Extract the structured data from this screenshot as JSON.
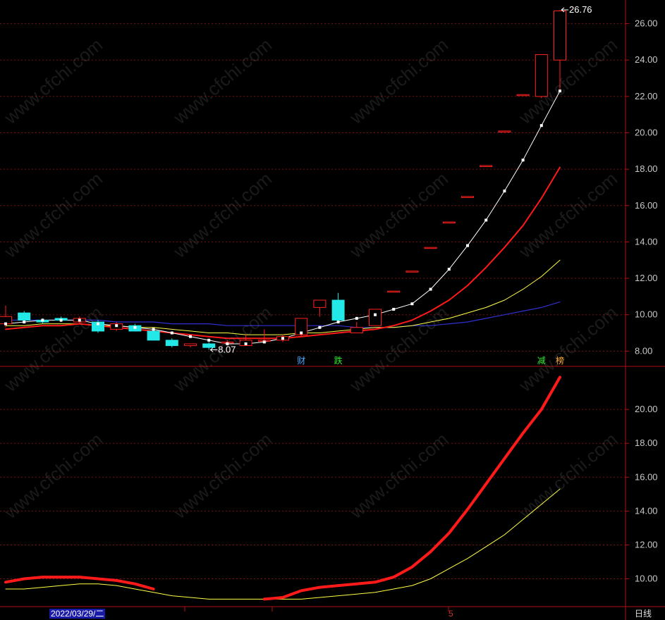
{
  "chart_data": [
    {
      "type": "candlestick",
      "ylim": [
        7.2,
        27.3
      ],
      "yticks": [
        8,
        10,
        12,
        14,
        16,
        18,
        20,
        22,
        24,
        26
      ],
      "ytick_labels": [
        "8.00",
        "10.00",
        "12.00",
        "14.00",
        "16.00",
        "18.00",
        "20.00",
        "22.00",
        "24.00",
        "26.00"
      ],
      "grid": true,
      "candles": [
        {
          "o": 9.5,
          "h": 10.5,
          "l": 9.3,
          "c": 9.9
        },
        {
          "o": 10.1,
          "h": 10.2,
          "l": 9.7,
          "c": 9.7
        },
        {
          "o": 9.7,
          "h": 9.8,
          "l": 9.5,
          "c": 9.6
        },
        {
          "o": 9.8,
          "h": 9.9,
          "l": 9.6,
          "c": 9.7
        },
        {
          "o": 9.6,
          "h": 9.9,
          "l": 9.5,
          "c": 9.8
        },
        {
          "o": 9.6,
          "h": 9.7,
          "l": 9.0,
          "c": 9.1
        },
        {
          "o": 9.2,
          "h": 9.6,
          "l": 9.1,
          "c": 9.5
        },
        {
          "o": 9.4,
          "h": 9.5,
          "l": 9.1,
          "c": 9.1
        },
        {
          "o": 9.1,
          "h": 9.2,
          "l": 8.6,
          "c": 8.6
        },
        {
          "o": 8.6,
          "h": 8.7,
          "l": 8.2,
          "c": 8.3
        },
        {
          "o": 8.3,
          "h": 8.4,
          "l": 8.2,
          "c": 8.4
        },
        {
          "o": 8.4,
          "h": 8.5,
          "l": 8.07,
          "c": 8.2
        },
        {
          "o": 8.5,
          "h": 8.6,
          "l": 8.3,
          "c": 8.5
        },
        {
          "o": 8.3,
          "h": 8.9,
          "l": 8.3,
          "c": 8.6
        },
        {
          "o": 8.6,
          "h": 9.2,
          "l": 8.5,
          "c": 8.6
        },
        {
          "o": 8.6,
          "h": 8.9,
          "l": 8.5,
          "c": 8.8
        },
        {
          "o": 8.9,
          "h": 9.8,
          "l": 8.8,
          "c": 9.8
        },
        {
          "o": 10.4,
          "h": 10.8,
          "l": 9.9,
          "c": 10.8
        },
        {
          "o": 10.8,
          "h": 11.2,
          "l": 9.6,
          "c": 9.7
        },
        {
          "o": 9.0,
          "h": 9.6,
          "l": 9.0,
          "c": 9.3
        },
        {
          "o": 9.4,
          "h": 10.3,
          "l": 9.4,
          "c": 10.3
        },
        {
          "o": 11.3,
          "h": 11.3,
          "l": 11.3,
          "c": 11.3
        },
        {
          "o": 12.4,
          "h": 12.4,
          "l": 12.4,
          "c": 12.4
        },
        {
          "o": 13.7,
          "h": 13.7,
          "l": 13.7,
          "c": 13.7
        },
        {
          "o": 15.1,
          "h": 15.1,
          "l": 15.1,
          "c": 15.1
        },
        {
          "o": 16.5,
          "h": 16.5,
          "l": 16.5,
          "c": 16.5
        },
        {
          "o": 18.2,
          "h": 18.2,
          "l": 18.2,
          "c": 18.2
        },
        {
          "o": 20.1,
          "h": 20.1,
          "l": 20.1,
          "c": 20.1
        },
        {
          "o": 22.1,
          "h": 22.1,
          "l": 22.1,
          "c": 22.1
        },
        {
          "o": 22.0,
          "h": 24.3,
          "l": 21.9,
          "c": 24.3
        },
        {
          "o": 24.0,
          "h": 26.76,
          "l": 22.4,
          "c": 26.7
        }
      ],
      "series": [
        {
          "color": "#ffffff",
          "markers": true,
          "values": [
            9.5,
            9.6,
            9.7,
            9.7,
            9.7,
            9.5,
            9.4,
            9.3,
            9.2,
            9.0,
            8.8,
            8.6,
            8.4,
            8.4,
            8.5,
            8.7,
            9.0,
            9.3,
            9.6,
            9.8,
            10.0,
            10.3,
            10.6,
            11.4,
            12.5,
            13.8,
            15.2,
            16.8,
            18.5,
            20.4,
            22.3
          ]
        },
        {
          "color": "#ff1a1a",
          "values": [
            9.2,
            9.3,
            9.4,
            9.4,
            9.5,
            9.4,
            9.3,
            9.2,
            9.1,
            9.0,
            8.9,
            8.8,
            8.7,
            8.7,
            8.7,
            8.7,
            8.8,
            8.9,
            9.0,
            9.1,
            9.2,
            9.4,
            9.7,
            10.2,
            10.8,
            11.6,
            12.6,
            13.7,
            14.9,
            16.4,
            18.1
          ]
        },
        {
          "color": "#ffff44",
          "values": [
            9.4,
            9.4,
            9.5,
            9.5,
            9.5,
            9.4,
            9.4,
            9.3,
            9.3,
            9.2,
            9.1,
            9.0,
            9.0,
            8.9,
            8.9,
            8.9,
            9.0,
            9.0,
            9.1,
            9.2,
            9.3,
            9.3,
            9.4,
            9.6,
            9.8,
            10.1,
            10.4,
            10.8,
            11.4,
            12.1,
            13.0
          ]
        },
        {
          "color": "#3030d0",
          "values": [
            9.7,
            9.7,
            9.7,
            9.7,
            9.7,
            9.7,
            9.6,
            9.6,
            9.6,
            9.5,
            9.5,
            9.5,
            9.4,
            9.4,
            9.4,
            9.4,
            9.4,
            9.4,
            9.4,
            9.3,
            9.3,
            9.3,
            9.4,
            9.4,
            9.5,
            9.6,
            9.8,
            10.0,
            10.2,
            10.4,
            10.7
          ]
        }
      ],
      "annotations": [
        {
          "text": "8.07",
          "index": 11,
          "value": 8.07
        },
        {
          "text": "26.76",
          "index": 30,
          "value": 26.76
        }
      ],
      "event_tags": [
        {
          "text": "财",
          "index": 16,
          "color": "#4ea8ff"
        },
        {
          "text": "跌",
          "index": 18,
          "color": "#33ee33"
        },
        {
          "text": "减",
          "index": 29,
          "color": "#33ee33"
        },
        {
          "text": "榜",
          "index": 30,
          "color": "#ffaa33"
        }
      ]
    },
    {
      "type": "line",
      "ylim": [
        8.4,
        22.5
      ],
      "yticks": [
        10,
        12,
        14,
        16,
        18,
        20
      ],
      "ytick_labels": [
        "10.00",
        "12.00",
        "14.00",
        "16.00",
        "18.00",
        "20.00"
      ],
      "grid": true,
      "series": [
        {
          "color": "#ff1a1a",
          "thick": true,
          "values": [
            9.8,
            10.0,
            10.1,
            10.1,
            10.1,
            10.0,
            9.9,
            9.7,
            9.4,
            null,
            null,
            null,
            null,
            null,
            8.8,
            8.9,
            9.3,
            9.5,
            9.6,
            9.7,
            9.8,
            10.1,
            10.7,
            11.6,
            12.7,
            14.1,
            15.6,
            17.1,
            18.6,
            20.0,
            21.9
          ]
        },
        {
          "color": "#ffff44",
          "values": [
            9.4,
            9.4,
            9.5,
            9.6,
            9.7,
            9.7,
            9.6,
            9.4,
            9.2,
            9.0,
            8.9,
            8.8,
            8.8,
            8.8,
            8.8,
            8.8,
            8.8,
            8.9,
            9.0,
            9.1,
            9.2,
            9.4,
            9.6,
            10.0,
            10.6,
            11.2,
            11.9,
            12.6,
            13.5,
            14.4,
            15.3
          ]
        }
      ]
    }
  ],
  "xaxis": {
    "date_label": "2022/03/29/二",
    "month_label": "5",
    "period_label": "日线"
  },
  "watermark": "www.cfchi.com"
}
